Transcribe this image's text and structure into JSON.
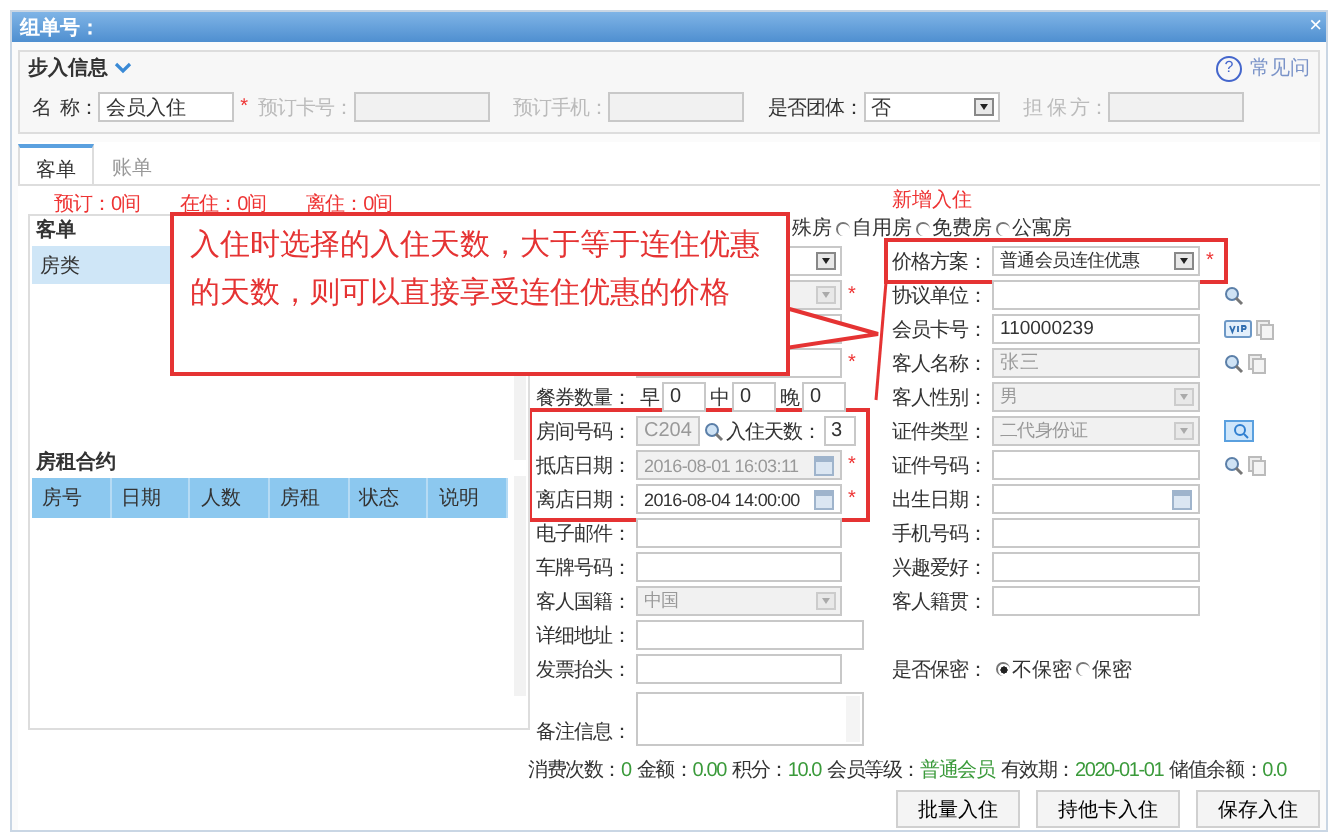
{
  "window": {
    "title": "组单号：",
    "close": "×"
  },
  "help": {
    "icon": "?",
    "label": "常见问"
  },
  "entry": {
    "title": "步入信息",
    "fields": [
      {
        "kind": "text",
        "label": "名  称：",
        "value": "会员入住",
        "mark": "*",
        "disabled": false
      },
      {
        "kind": "text",
        "label": "预订卡号：",
        "disabled": true
      },
      {
        "kind": "text",
        "label": "预订手机：",
        "disabled": true
      },
      {
        "kind": "select",
        "label": "是否团体：",
        "value": "否",
        "disabled": false
      },
      {
        "kind": "text",
        "label": "担 保 方：",
        "disabled": true
      }
    ]
  },
  "tabs": [
    {
      "label": "客单",
      "selected": true
    },
    {
      "label": "账单",
      "selected": false
    }
  ],
  "stats": [
    "预订：0间",
    "在住：0间",
    "离住：0间"
  ],
  "form_title": "新增入住",
  "guest_list": {
    "title": "客单",
    "rows": [
      "房类"
    ]
  },
  "contract": {
    "title": "房租合约",
    "columns": [
      "房号",
      "日期",
      "人数",
      "房租",
      "状态",
      "说明"
    ]
  },
  "callout": {
    "text": "入住时选择的入住天数，大于等于连住优惠的天数，则可以直接享受连住优惠的价格"
  },
  "room_type": {
    "partial_label": "殊房",
    "options": [
      {
        "label": "自用房",
        "selected": false
      },
      {
        "label": "免费房",
        "selected": false
      },
      {
        "label": "公寓房",
        "selected": false
      }
    ]
  },
  "rows": [
    {
      "left": {
        "kind": "select",
        "disabled": false
      },
      "right": {
        "kind": "select",
        "label": "价格方案：",
        "value": "普通会员连住优惠",
        "disabled": false,
        "mark": "*"
      }
    },
    {
      "left": {
        "kind": "select",
        "disabled": true,
        "mark": "*"
      },
      "right": {
        "kind": "text",
        "label": "协议单位：",
        "disabled": false
      }
    },
    {
      "left": {
        "kind": "text",
        "disabled": false
      },
      "right": {
        "kind": "text",
        "label": "会员卡号：",
        "value": "110000239",
        "disabled": false
      }
    },
    {
      "left": {
        "kind": "text",
        "disabled": false,
        "mark": "*"
      },
      "right": {
        "kind": "text",
        "label": "客人名称：",
        "value": "张三",
        "disabled": true
      }
    },
    {
      "left": {
        "kind": "meals",
        "label": "餐券数量：",
        "meals": [
          {
            "label": "早",
            "value": "0"
          },
          {
            "label": "中",
            "value": "0"
          },
          {
            "label": "晚",
            "value": "0"
          }
        ]
      },
      "right": {
        "kind": "select",
        "label": "客人性别：",
        "value": "男",
        "disabled": true
      }
    },
    {
      "left": {
        "kind": "room",
        "label": "房间号码：",
        "value": "C204",
        "days_label": "入住天数：",
        "days": "3"
      },
      "right": {
        "kind": "select",
        "label": "证件类型：",
        "value": "二代身份证",
        "disabled": true
      }
    },
    {
      "left": {
        "kind": "date",
        "label": "抵店日期：",
        "value": "2016-08-01 16:03:11",
        "disabled": true,
        "mark": "*"
      },
      "right": {
        "kind": "text",
        "label": "证件号码：",
        "disabled": false
      }
    },
    {
      "left": {
        "kind": "date",
        "label": "离店日期：",
        "value": "2016-08-04 14:00:00",
        "disabled": false,
        "mark": "*"
      },
      "right": {
        "kind": "date",
        "label": "出生日期：",
        "disabled": false
      }
    },
    {
      "left": {
        "kind": "text",
        "label": "电子邮件：",
        "disabled": false
      },
      "right": {
        "kind": "text",
        "label": "手机号码：",
        "disabled": false
      }
    },
    {
      "left": {
        "kind": "text",
        "label": "车牌号码：",
        "disabled": false
      },
      "right": {
        "kind": "text",
        "label": "兴趣爱好：",
        "disabled": false
      }
    },
    {
      "left": {
        "kind": "select",
        "label": "客人国籍：",
        "value": "中国",
        "disabled": true
      },
      "right": {
        "kind": "text",
        "label": "客人籍贯：",
        "disabled": false
      }
    },
    {
      "left": {
        "kind": "wide",
        "label": "详细地址：",
        "disabled": false
      }
    },
    {
      "left": {
        "kind": "text",
        "label": "发票抬头：",
        "disabled": false
      },
      "right": {
        "kind": "radio",
        "label": "是否保密：",
        "options": [
          {
            "label": "不保密",
            "selected": true
          },
          {
            "label": "保密",
            "selected": false
          }
        ]
      }
    },
    {
      "left": {
        "kind": "textarea",
        "label": "备注信息："
      }
    }
  ],
  "summary": [
    {
      "label": "消费次数：",
      "value": "0"
    },
    {
      "label": "金额：",
      "value": "0.00"
    },
    {
      "label": "积分：",
      "value": "10.0"
    },
    {
      "label": "会员等级：",
      "value": "普通会员"
    },
    {
      "label": "有效期：",
      "value": "2020-01-01"
    },
    {
      "label": "储值余额：",
      "value": "0.0"
    }
  ],
  "buttons": [
    "批量入住",
    "持他卡入住",
    "保存入住"
  ]
}
